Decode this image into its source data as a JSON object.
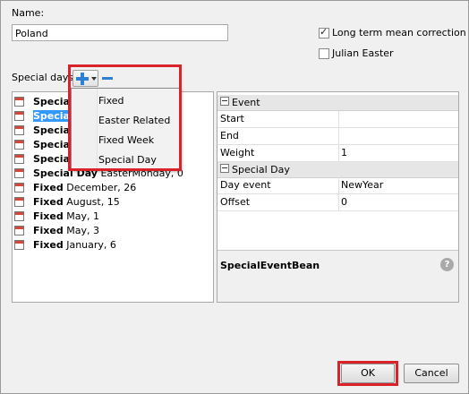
{
  "form": {
    "name_label": "Name:",
    "name_value": "Poland",
    "long_term_label": "Long term mean correction",
    "long_term_checked": true,
    "julian_label": "Julian Easter",
    "julian_checked": false,
    "special_days_label": "Special days:"
  },
  "toolbar": {
    "add_icon": "plus-icon",
    "dropdown_icon": "chevron-down-icon",
    "remove_icon": "minus-icon"
  },
  "list": [
    {
      "kind": "Special",
      "detail": ""
    },
    {
      "kind": "Special",
      "detail": "",
      "selected": true
    },
    {
      "kind": "Special",
      "detail": ""
    },
    {
      "kind": "Special",
      "detail": ""
    },
    {
      "kind": "Special",
      "detail": ""
    },
    {
      "kind": "Special Day",
      "detail": "EasterMonday, 0"
    },
    {
      "kind": "Fixed",
      "detail": "December, 26"
    },
    {
      "kind": "Fixed",
      "detail": "August, 15"
    },
    {
      "kind": "Fixed",
      "detail": "May, 1"
    },
    {
      "kind": "Fixed",
      "detail": "May, 3"
    },
    {
      "kind": "Fixed",
      "detail": "January, 6"
    }
  ],
  "menu": {
    "items": [
      "Fixed",
      "Easter Related",
      "Fixed Week",
      "Special Day"
    ]
  },
  "properties": {
    "group1": "Event",
    "start_label": "Start",
    "start_value": "",
    "end_label": "End",
    "end_value": "",
    "weight_label": "Weight",
    "weight_value": "1",
    "group2": "Special Day",
    "day_event_label": "Day event",
    "day_event_value": "NewYear",
    "offset_label": "Offset",
    "offset_value": "0",
    "description_title": "SpecialEventBean",
    "help_icon": "help-icon"
  },
  "buttons": {
    "ok": "OK",
    "cancel": "Cancel"
  },
  "colors": {
    "highlight": "#d9222a",
    "selection": "#3399ff",
    "add_icon": "#2f7fd6"
  }
}
